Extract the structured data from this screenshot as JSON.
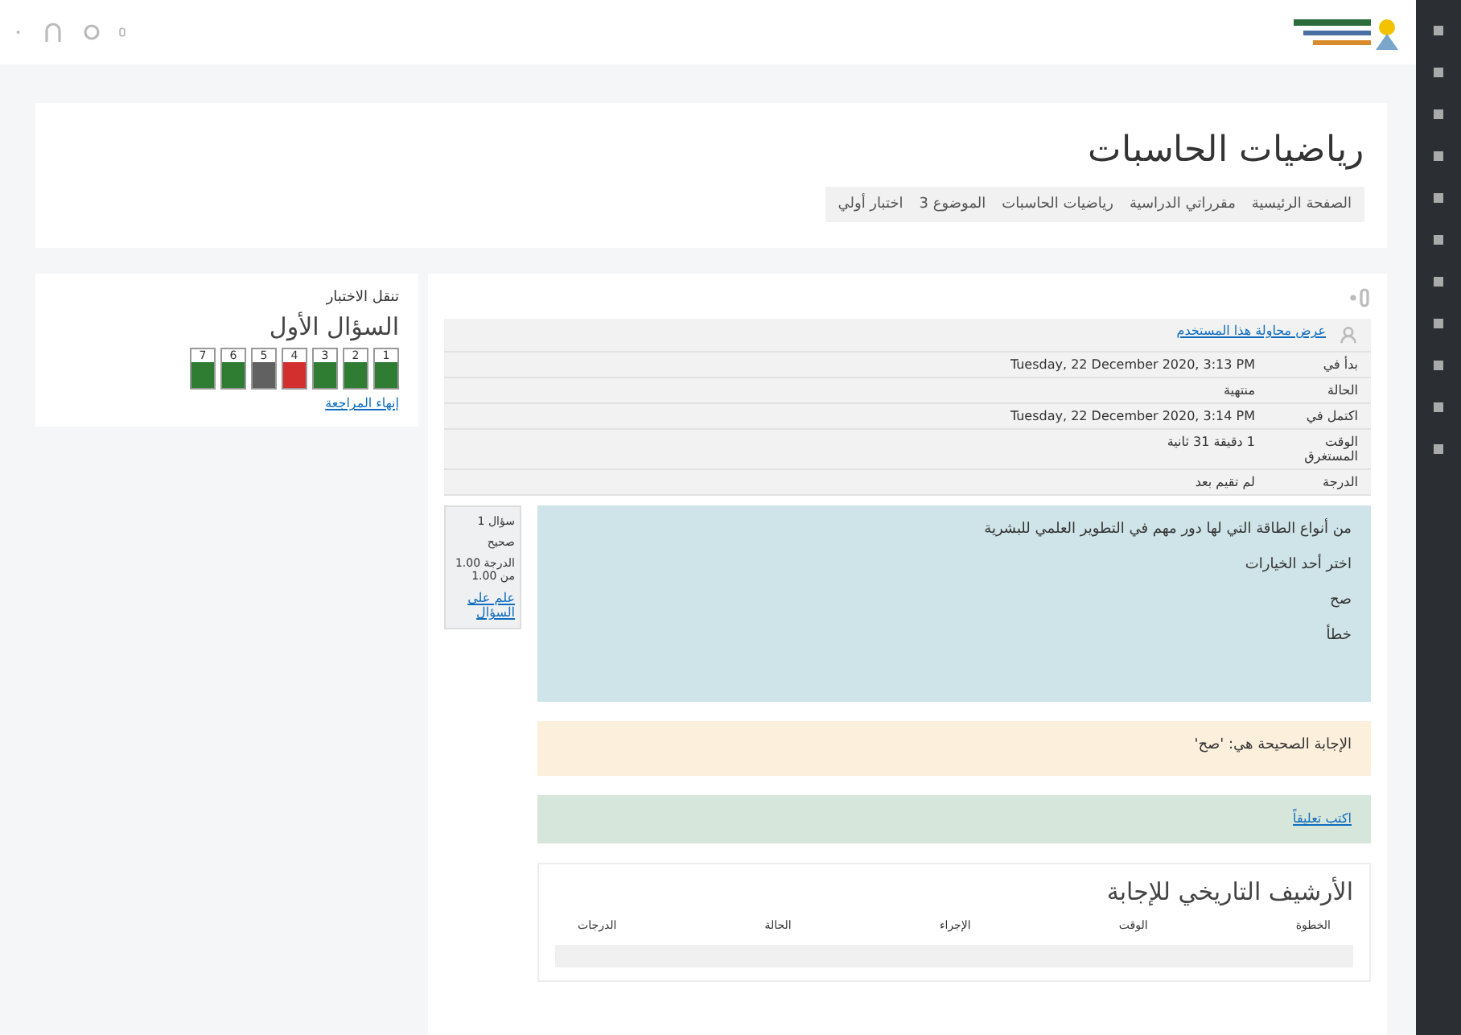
{
  "course": {
    "title": "رياضيات الحاسبات",
    "breadcrumbs": [
      "الصفحة الرئيسية",
      "مقرراتي الدراسية",
      "رياضيات الحاسبات",
      "الموضوع 3",
      "اختبار أولي"
    ]
  },
  "navigation": {
    "title": "تنقل الاختبار",
    "heading": "السؤال الأول",
    "questions": [
      {
        "number": "1",
        "color": "#2e7d32"
      },
      {
        "number": "2",
        "color": "#2e7d32"
      },
      {
        "number": "3",
        "color": "#2e7d32"
      },
      {
        "number": "4",
        "color": "#d32f2f"
      },
      {
        "number": "5",
        "color": "#616161"
      },
      {
        "number": "6",
        "color": "#2e7d32"
      },
      {
        "number": "7",
        "color": "#2e7d32"
      }
    ],
    "finish_link": "إنهاء المراجعة"
  },
  "summary": {
    "user_link": "عرض محاولة هذا المستخدم",
    "rows": [
      {
        "label": "بدأ في",
        "value": "Tuesday, 22 December 2020, 3:13 PM"
      },
      {
        "label": "الحالة",
        "value": "منتهية"
      },
      {
        "label": "اكتمل في",
        "value": "Tuesday, 22 December 2020, 3:14 PM"
      },
      {
        "label": "الوقت المستغرق",
        "value": "1 دقيقة 31 ثانية"
      },
      {
        "label": "الدرجة",
        "value": "لم تقيم بعد"
      }
    ]
  },
  "question": {
    "number": "سؤال 1",
    "state": "صحيح",
    "mark": "الدرجة 1.00 من 1.00",
    "flag": "علم على السؤال",
    "text": "من أنواع الطاقة التي لها دور مهم في التطوير العلمي للبشرية",
    "prompt": "اختر أحد الخيارات",
    "options": [
      "صح",
      "خطأ"
    ],
    "feedback": "الإجابة الصحيحة هي: 'صح'",
    "comment_link": "اكتب تعليقاً"
  },
  "history": {
    "title": "الأرشيف التاريخي للإجابة",
    "columns": [
      "الخطوة",
      "الوقت",
      "الإجراء",
      "الحالة",
      "الدرجات"
    ]
  }
}
